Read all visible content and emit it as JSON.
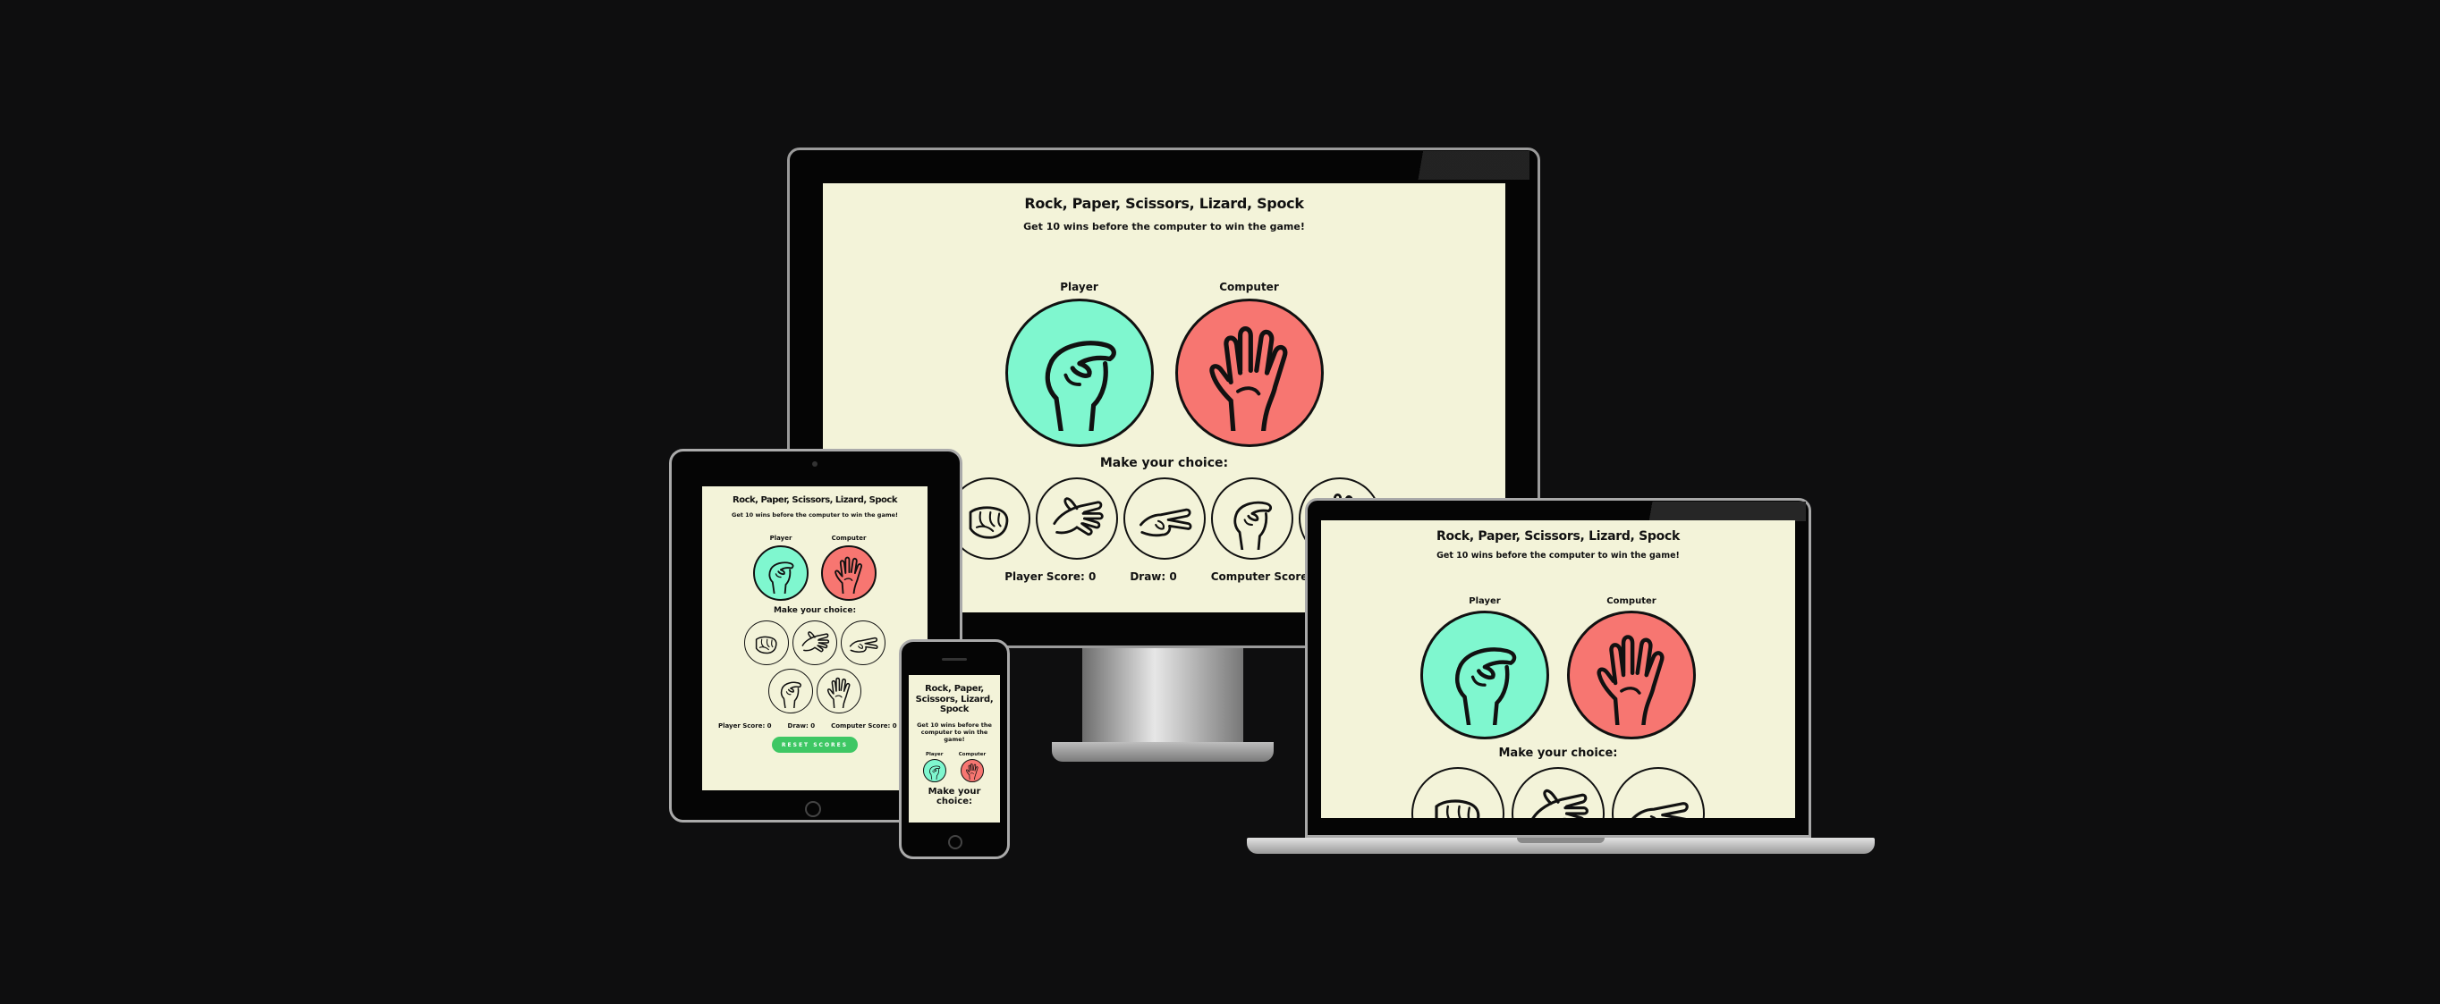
{
  "game": {
    "title": "Rock, Paper, Scissors, Lizard, Spock",
    "subtitle": "Get 10 wins before the computer to win the game!",
    "player_label": "Player",
    "computer_label": "Computer",
    "make_choice": "Make your choice:",
    "player_score": "Player Score: 0",
    "draw": "Draw: 0",
    "computer_score": "Computer Score: 0",
    "reset_button": "RESET SCORES",
    "player_hand": "lizard-hand-icon",
    "computer_hand": "spock-hand-icon",
    "choices": [
      "rock",
      "paper",
      "scissors",
      "lizard",
      "spock"
    ]
  },
  "colors": {
    "background": "#0e0e0f",
    "screen": "#f3f3d9",
    "player": "#7ff7cf",
    "computer": "#f77671",
    "reset": "#3ec764"
  }
}
